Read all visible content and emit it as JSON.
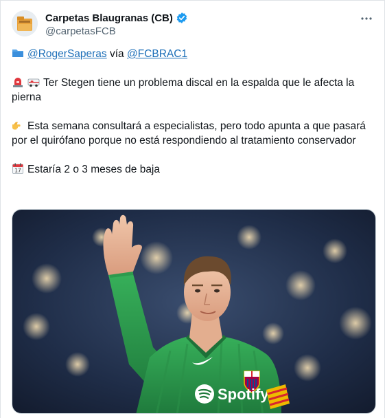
{
  "author": {
    "display_name": "Carpetas Blaugranas (CB)",
    "handle": "@carpetasFCB",
    "verified": true
  },
  "tweet": {
    "line1": {
      "mention_a": "@RogerSaperas",
      "via": " vía ",
      "mention_b": "@FCBRAC1"
    },
    "line2": "Ter Stegen tiene un problema discal en la espalda que le afecta la pierna",
    "line3": "Esta semana consultará a especialistas, pero todo apunta a que pasará por el quirófano porque no está respondiendo al tratamiento conservador",
    "line4": "Estaría 2 o 3 meses de baja"
  },
  "media": {
    "jersey_logo_text": "Spotify"
  },
  "icons": {
    "folder": "folder-icon",
    "siren": "siren-icon",
    "ambulance": "ambulance-icon",
    "pointing_hand": "pointing-hand-icon",
    "calendar": "calendar-icon",
    "more": "more-icon",
    "verified": "verified-badge-icon"
  },
  "colors": {
    "link": "#1d6fb8",
    "verified": "#1d9bf0",
    "secondary_text": "#536471"
  }
}
